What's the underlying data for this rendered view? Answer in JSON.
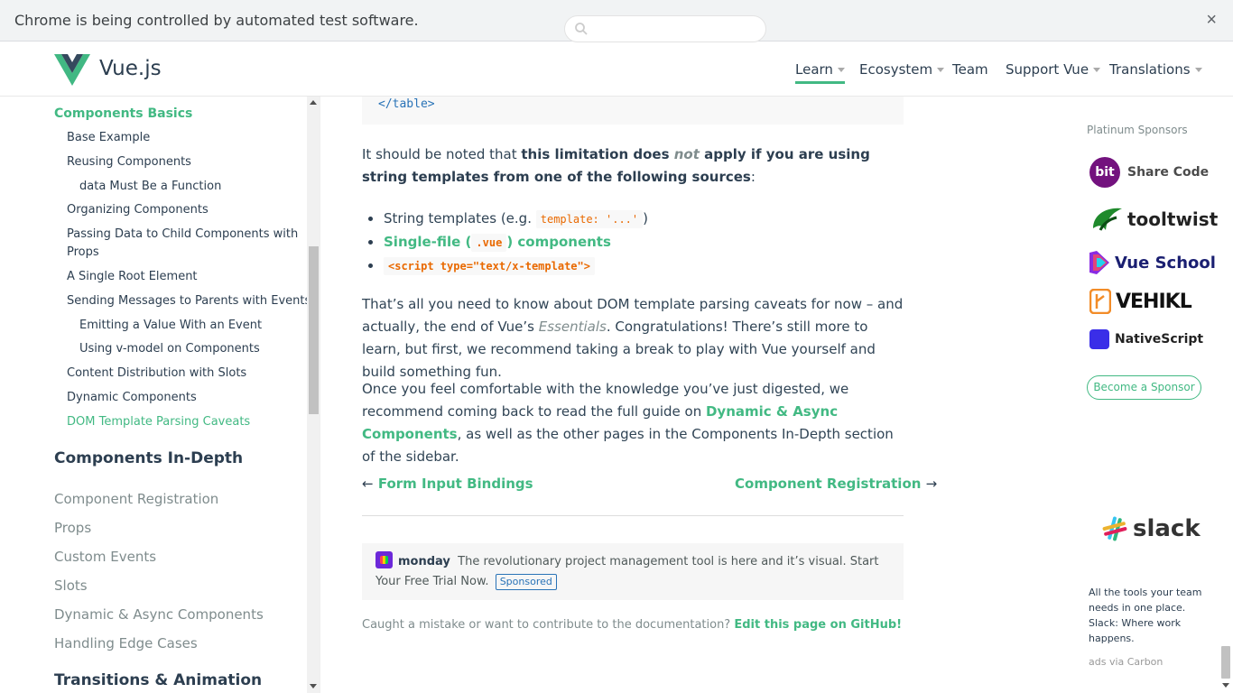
{
  "infobar": {
    "message": "Chrome is being controlled by automated test software.",
    "close": "×"
  },
  "header": {
    "brand": "Vue.js",
    "search_placeholder": "",
    "nav": [
      "Learn",
      "Ecosystem",
      "Team",
      "Support Vue",
      "Translations"
    ],
    "accent_color": "#42b983"
  },
  "sidebar": {
    "current_section": "Components Basics",
    "items": [
      "Base Example",
      "Reusing Components",
      "data Must Be a Function",
      "Organizing Components",
      "Passing Data to Child Components with",
      "Props",
      "A Single Root Element",
      "Sending Messages to Parents with Events",
      "Emitting a Value With an Event",
      "Using v-model on Components",
      "Content Distribution with Slots",
      "Dynamic Components",
      "DOM Template Parsing Caveats"
    ],
    "heading_in_depth": "Components In-Depth",
    "in_depth_items": [
      "Component Registration",
      "Props",
      "Custom Events",
      "Slots",
      "Dynamic & Async Components",
      "Handling Edge Cases"
    ],
    "heading_transitions": "Transitions & Animation"
  },
  "content": {
    "code_end": "</table>",
    "p1_a": "It should be noted that ",
    "p1_b": "this limitation does ",
    "p1_c": "not",
    "p1_d": " apply if you are using string templates from one of the following sources",
    "p1_e": ":",
    "b1_a": "String templates (e.g. ",
    "b1_code": "template: '...'",
    "b1_b": ")",
    "b2_a": "Single-file (",
    "b2_code": ".vue",
    "b2_b": ") components",
    "b3_code": "<script type=\"text/x-template\">",
    "p2_a": "That’s all you need to know about DOM template parsing caveats for now – and actually, the end of Vue’s ",
    "p2_i": "Essentials",
    "p2_b": ". Congratulations! There’s still more to learn, but first, we recommend taking a break to play with Vue yourself and build something fun.",
    "p3_a": "Once you feel comfortable with the knowledge you’ve just digested, we recommend coming back to read the full guide on ",
    "p3_link": "Dynamic & Async Components",
    "p3_b": ", as well as the other pages in the Components In-Depth section of the sidebar.",
    "prev_arrow": "←",
    "prev": "Form Input Bindings",
    "next": "Component Registration",
    "next_arrow": "→",
    "ad_brand": "monday",
    "ad_text": "The revolutionary project management tool is here and it’s visual. Start Your Free Trial Now.",
    "ad_badge": "Sponsored",
    "edit_text": "Caught a mistake or want to contribute to the documentation? ",
    "edit_link": "Edit this page on GitHub!"
  },
  "right": {
    "platinum_title": "Platinum Sponsors",
    "sponsors": [
      "bit",
      "Share Code",
      "tooltwist",
      "Vue School",
      "VEHIKL",
      "NativeScript"
    ],
    "become": "Become a Sponsor",
    "slack": "slack",
    "carbon_desc": "All the tools your team needs in one place. Slack: Where work happens.",
    "carbon_via": "ads via Carbon"
  }
}
